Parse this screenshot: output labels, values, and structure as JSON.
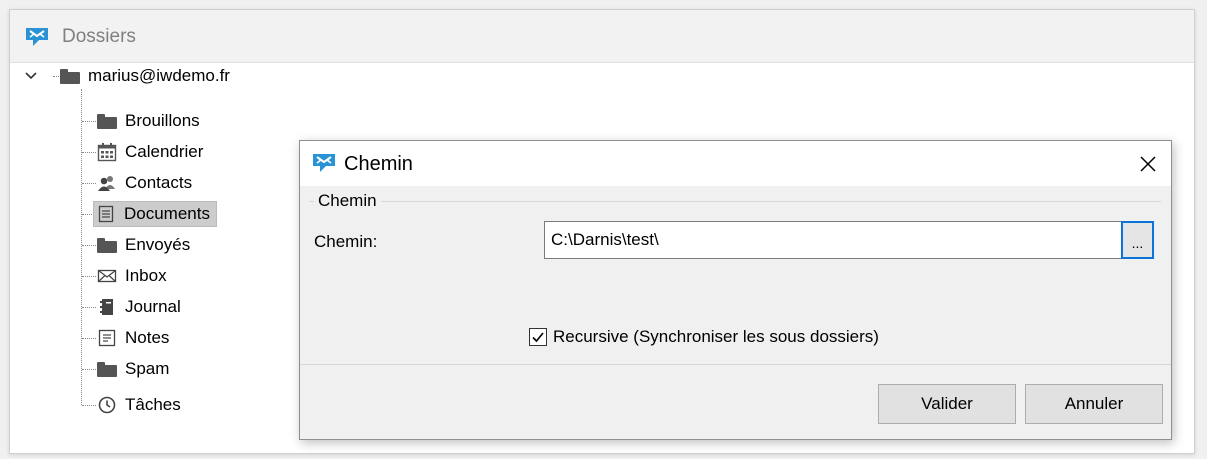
{
  "window": {
    "title": "Dossiers"
  },
  "tree": {
    "root": {
      "label": "marius@iwdemo.fr",
      "expanded": true
    },
    "items": [
      {
        "label": "Brouillons",
        "icon": "folder-icon"
      },
      {
        "label": "Calendrier",
        "icon": "calendar-icon"
      },
      {
        "label": "Contacts",
        "icon": "contacts-icon"
      },
      {
        "label": "Documents",
        "icon": "document-icon",
        "selected": true
      },
      {
        "label": "Envoyés",
        "icon": "folder-icon"
      },
      {
        "label": "Inbox",
        "icon": "mail-icon"
      },
      {
        "label": "Journal",
        "icon": "journal-icon"
      },
      {
        "label": "Notes",
        "icon": "notes-icon"
      },
      {
        "label": "Spam",
        "icon": "folder-icon"
      },
      {
        "label": "Tâches",
        "icon": "clock-icon"
      }
    ]
  },
  "dialog": {
    "title": "Chemin",
    "group_label": "Chemin",
    "field_label": "Chemin:",
    "path_value": "C:\\Darnis\\test\\",
    "browse_label": "...",
    "recursive_label": "Recursive (Synchroniser les sous dossiers)",
    "recursive_checked": true,
    "ok_label": "Valider",
    "cancel_label": "Annuler"
  },
  "colors": {
    "app_icon": "#2a93d5",
    "selection": "#cccccc",
    "focus_border": "#0a74d8"
  }
}
